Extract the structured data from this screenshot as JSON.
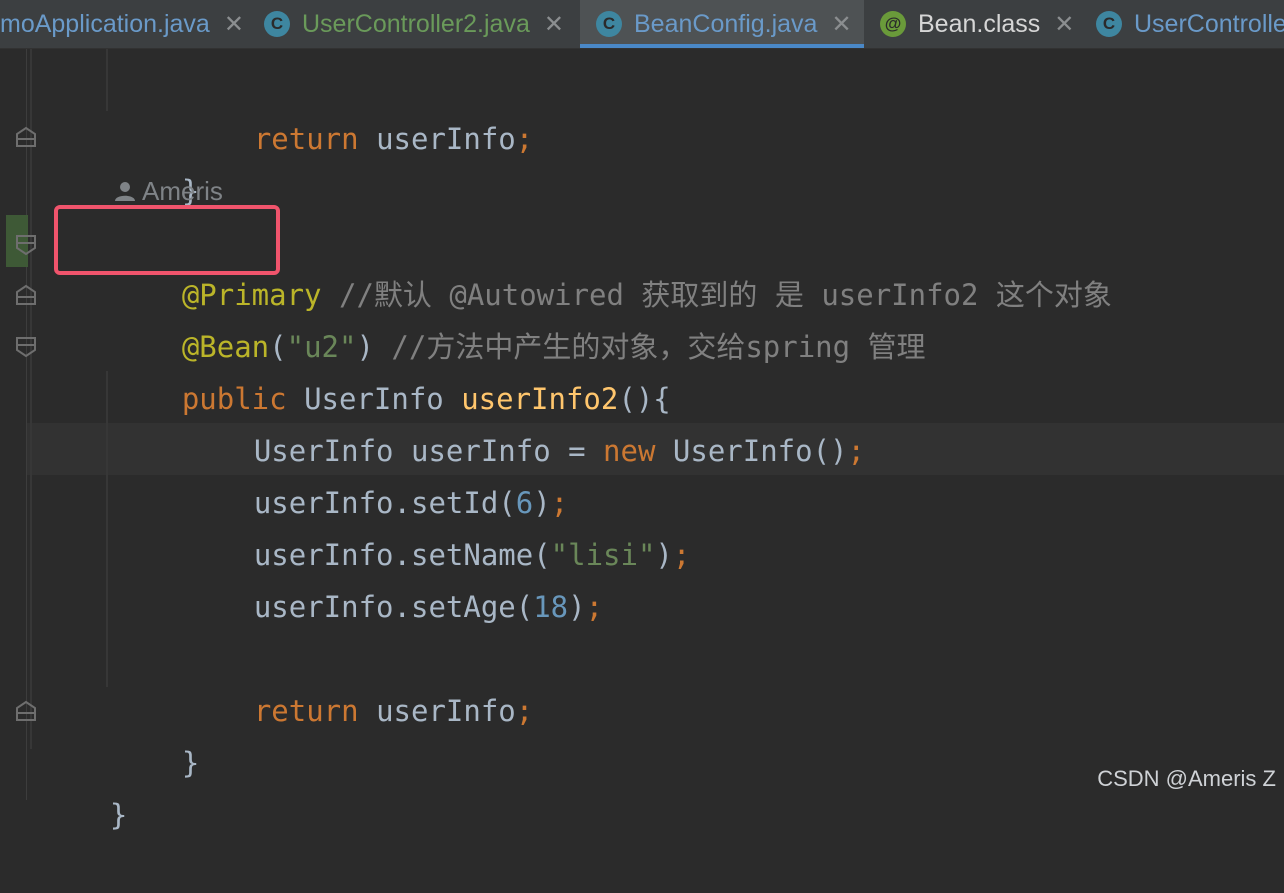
{
  "tabs": [
    {
      "label": "moApplication.java",
      "color": "#6a9ac9",
      "icon": "none",
      "close": "✕"
    },
    {
      "label": "UserController2.java",
      "color": "#6a9a5a",
      "icon": "class-icon",
      "close": "✕"
    },
    {
      "label": "BeanConfig.java",
      "color": "#6a9ac9",
      "icon": "class-icon",
      "close": "✕",
      "active": true
    },
    {
      "label": "Bean.class",
      "color": "#d6d6d6",
      "icon": "annotation-icon",
      "close": "✕"
    },
    {
      "label": "UserControlle",
      "color": "#6a9ac9",
      "icon": "class-icon",
      "close": ""
    }
  ],
  "editor": {
    "author": "Ameris",
    "code": {
      "l1_kw": "return",
      "l1_rest": " userInfo",
      "l1_semi": ";",
      "l2": "}",
      "l3_ann": "@Primary",
      "l3_cmt": " //默认 @Autowired 获取到的 是 userInfo2 这个对象",
      "l4_ann": "@Bean",
      "l4_p1": "(",
      "l4_str": "\"u2\"",
      "l4_p2": ")",
      "l4_cmt": " //方法中产生的对象，交给spring 管理",
      "l5_kw": "public",
      "l5_type": " UserInfo ",
      "l5_fn": "userInfo2",
      "l5_rest": "(){",
      "l6_a": "UserInfo userInfo = ",
      "l6_kw": "new",
      "l6_b": " UserInfo()",
      "l6_semi": ";",
      "l7_a": "userInfo.setId(",
      "l7_num": "6",
      "l7_b": ")",
      "l7_semi": ";",
      "l8_a": "userInfo.setName(",
      "l8_str": "\"lisi\"",
      "l8_b": ")",
      "l8_semi": ";",
      "l9_a": "userInfo.setAge(",
      "l9_num": "18",
      "l9_b": ")",
      "l9_semi": ";",
      "l11_kw": "return",
      "l11_rest": " userInfo",
      "l11_semi": ";",
      "l12": "}",
      "l13": "}"
    }
  },
  "watermark": "CSDN @Ameris Z"
}
